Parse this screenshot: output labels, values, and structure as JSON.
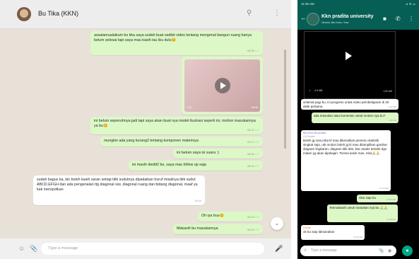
{
  "desktop": {
    "contact_name": "Bu Tika (KKN)",
    "icons": {
      "search": "search-icon",
      "menu": "more-vert-icon"
    },
    "messages": [
      {
        "text": "assalamualaikum bu tika saya sudah buat sedikit video tentang mengenal bangun ruang hanya belum selesai tapi saya mau kasih tau ibu dulu😊",
        "time": "08:38"
      },
      {
        "video_duration": "1:14",
        "time": "08:38"
      },
      {
        "text": "ini belum sepenuhnya jadi tapi saya akan buat nya model ilustrasi seperti ini, mohon masukannya ya bu😊",
        "time": "08:37"
      },
      {
        "text": "mungkin ada yang kurang2 tentang komponen materinya",
        "time": "08:37"
      },
      {
        "text": "ini belum saya isi suara :)",
        "time": "08:38"
      },
      {
        "text": "ini masih diedit2 bu, saya mau follow up saja",
        "time": "08:44"
      },
      {
        "text": "sudah bagus ka, klo boleh kasih saran setiap titik sudutnya dipakaikan huruf misalnya titik sudut ABCD.EFGH dan ada pengenalan ttg diagonal sisi, diagonal ruang dan bidang diagonal, maaf ya kak merepotkan",
        "time": "08:49"
      },
      {
        "text": "Oh iya buu😊",
        "time": "08:49"
      },
      {
        "text": "Makasih bu masukannya",
        "time": "08:49"
      }
    ],
    "composer_placeholder": "Type a message"
  },
  "mobile": {
    "status_time": "11:45 AM",
    "status_icons": "⊿ ≋ ▭",
    "group_name": "Kkn pradita university",
    "group_subtitle": "Diretod, Bia ernes, Yoac",
    "video": {
      "size": "4.5 MB",
      "time": "1:52 AM"
    },
    "messages": [
      {
        "text": "selamat pagi bu, ini progress untuk video pembelajaran di 20 detik pertama",
        "time": "1:52 AM"
      },
      {
        "text": "ada masukan atau komentar untuk motion nya bu?",
        "time": "1:52 AM"
      },
      {
        "sender": "Bia erma kkn pradita",
        "quote": "Ok Reoled",
        "text": "Boleh jg mas,mba kl mau dikenalkan penemu statistik singkat saja, utk motion boleh jg kl mau ditampilkan gambar diagram lingkaran, diagram titik dsb, biar anak2 tertarik dgn materi yg akan dipelajari. Terima kasih mas, mba🙏🙏",
        "time": "11:33 AM"
      },
      {
        "text": "Oke siap bu",
        "time": "11:38 AM"
      },
      {
        "text": "Terimakasih untuk masukan nya bu 🙏🙏",
        "time": "11:38 AM"
      },
      {
        "sender": "Dinnal",
        "text": "ok bu siap laksanakan",
        "time": "11:45 AM"
      }
    ],
    "composer_placeholder": "Type a message"
  },
  "colors": {
    "outgoing_bubble": "#dcf8c6",
    "incoming_bubble": "#ffffff",
    "whatsapp_teal": "#075e54",
    "desktop_wallpaper": "#e8e1d8"
  }
}
